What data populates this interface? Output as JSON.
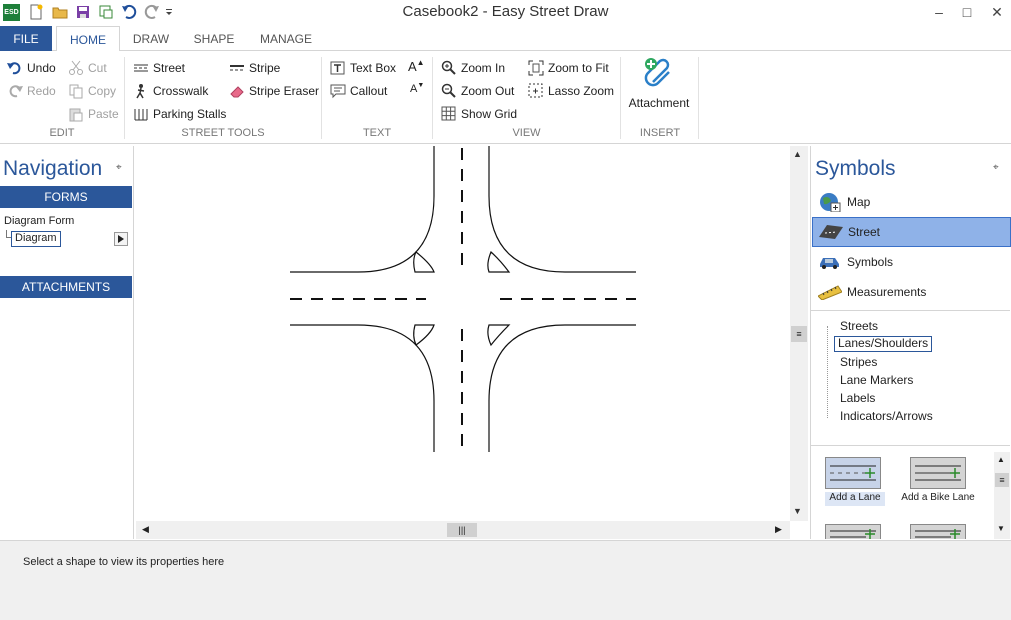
{
  "app": {
    "title": "Casebook2 - Easy Street Draw",
    "logo_text": "ESD"
  },
  "window": {
    "minimize_icon": "minimize-icon",
    "maximize_icon": "maximize-icon",
    "close_icon": "close-icon"
  },
  "tabs": [
    {
      "label": "FILE"
    },
    {
      "label": "HOME"
    },
    {
      "label": "DRAW"
    },
    {
      "label": "SHAPE"
    },
    {
      "label": "MANAGE"
    }
  ],
  "ribbon": {
    "edit": {
      "group": "EDIT",
      "undo": "Undo",
      "redo": "Redo",
      "cut": "Cut",
      "copy": "Copy",
      "paste": "Paste"
    },
    "street_tools": {
      "group": "STREET TOOLS",
      "street": "Street",
      "crosswalk": "Crosswalk",
      "parking_stalls": "Parking Stalls",
      "stripe": "Stripe",
      "stripe_eraser": "Stripe Eraser"
    },
    "text": {
      "group": "TEXT",
      "text_box": "Text Box",
      "callout": "Callout",
      "grow": "A",
      "shrink": "A"
    },
    "view": {
      "group": "VIEW",
      "zoom_in": "Zoom In",
      "zoom_out": "Zoom Out",
      "show_grid": "Show Grid",
      "zoom_to_fit": "Zoom to Fit",
      "lasso_zoom": "Lasso Zoom"
    },
    "insert": {
      "group": "INSERT",
      "attachment": "Attachment"
    }
  },
  "navigation": {
    "title": "Navigation",
    "forms_header": "FORMS",
    "diagram_form": "Diagram Form",
    "diagram": "Diagram",
    "attachments_header": "ATTACHMENTS"
  },
  "symbols": {
    "title": "Symbols",
    "categories": [
      {
        "label": "Map",
        "icon": "map-globe-icon",
        "selected": false
      },
      {
        "label": "Street",
        "icon": "street-icon",
        "selected": true
      },
      {
        "label": "Symbols",
        "icon": "car-icon",
        "selected": false
      },
      {
        "label": "Measurements",
        "icon": "ruler-icon",
        "selected": false
      }
    ],
    "tree": [
      "Streets",
      "Lanes/Shoulders",
      "Stripes",
      "Lane Markers",
      "Labels",
      "Indicators/Arrows"
    ],
    "tree_selected": "Lanes/Shoulders",
    "gallery": [
      {
        "label": "Add a Lane"
      },
      {
        "label": "Add a Bike Lane"
      }
    ]
  },
  "status": {
    "text": "Select a shape to view its properties here"
  },
  "colors": {
    "accent": "#2b579a",
    "selected_bg": "#8fb2e8"
  }
}
